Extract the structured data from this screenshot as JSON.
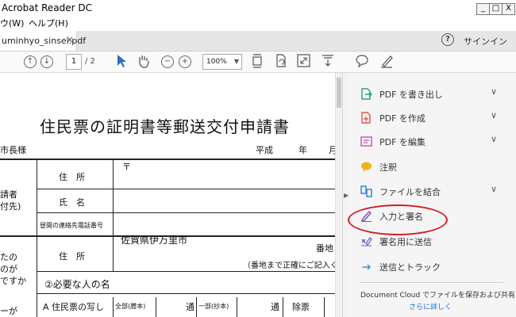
{
  "window": {
    "title": "Acrobat Reader DC",
    "controls": {
      "minimize": "_",
      "maximize": "□",
      "close": "X"
    }
  },
  "menu": {
    "items": [
      "ウ(W)",
      "ヘルプ(H)"
    ]
  },
  "tab": {
    "filename": "uminhyo_sinsei.pdf",
    "close": "×"
  },
  "header": {
    "help": "?",
    "signin": "サインイン"
  },
  "toolbar": {
    "page_current": "1",
    "page_total": "/ 2",
    "zoom": "100%"
  },
  "document": {
    "title": "住民票の証明書等郵送交付申請書",
    "addressee": "市長様",
    "era": "平成",
    "year": "年",
    "month": "月",
    "applicant_label_1": "請者",
    "applicant_label_2": "付先)",
    "address_label": "住　所",
    "postal_mark": "〒",
    "name_label": "氏　名",
    "phone_label": "昼間の連絡先電話番号",
    "target_label_1": "たの",
    "target_label_2": "のが",
    "target_label_3": "ですか",
    "target_address_label": "住　所",
    "target_city": "佐賀県伊万里市",
    "banchi": "番地",
    "note": "（番地まで正確にご記入く",
    "need_person": "②必要な人の名",
    "row_label": "ーが",
    "jumin_copy": "A 住民票の写し",
    "zenbu": "全部(謄本)",
    "tsu1": "通",
    "ichibu": "一部(抄本)",
    "tsu2": "通",
    "jogai": "除票"
  },
  "panel": {
    "tools": [
      {
        "label": "PDF を書き出し",
        "icon": "export-pdf-icon",
        "color": "#2aa36b",
        "chevron": true
      },
      {
        "label": "PDF を作成",
        "icon": "create-pdf-icon",
        "color": "#e0554a",
        "chevron": true
      },
      {
        "label": "PDF を編集",
        "icon": "edit-pdf-icon",
        "color": "#c34fb3",
        "chevron": true
      },
      {
        "label": "注釈",
        "icon": "comment-icon",
        "color": "#f2b31a",
        "chevron": false
      },
      {
        "label": "ファイルを結合",
        "icon": "combine-files-icon",
        "color": "#2f7bd8",
        "chevron": true
      },
      {
        "label": "入力と署名",
        "icon": "fill-sign-icon",
        "color": "#7a54b8",
        "chevron": false
      },
      {
        "label": "署名用に送信",
        "icon": "send-for-signature-icon",
        "color": "#6a53b5",
        "chevron": false
      },
      {
        "label": "送信とトラック",
        "icon": "send-track-icon",
        "color": "#3c8ed6",
        "chevron": false
      }
    ],
    "chevron": "∨",
    "cloud_text": "Document Cloud でファイルを保存および共有",
    "cloud_link": "さらに詳しく"
  }
}
